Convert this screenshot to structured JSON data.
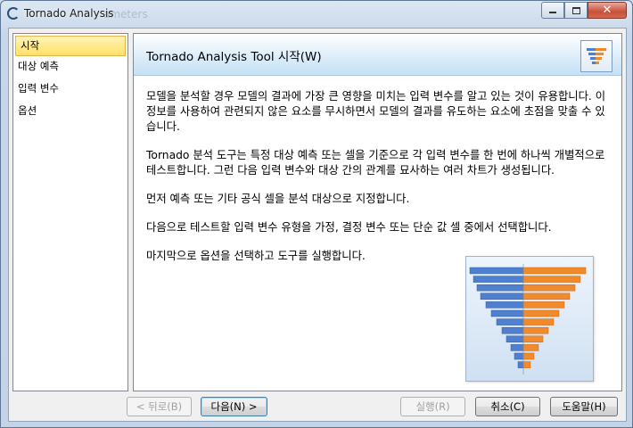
{
  "window": {
    "title": "Tornado Analysis",
    "ghost_title": "ameters",
    "min_icon": "minimize-icon",
    "max_icon": "maximize-icon",
    "close_icon": "close-icon",
    "close_glyph": "✕"
  },
  "nav": {
    "items": [
      {
        "label": "시작",
        "active": true
      },
      {
        "label": "대상 예측",
        "active": false
      },
      {
        "label": "입력 변수",
        "active": false
      },
      {
        "label": "옵션",
        "active": false
      }
    ]
  },
  "panel": {
    "title": "Tornado  Analysis  Tool 시작(W)",
    "header_icon": "tornado-chart-icon",
    "paragraphs": [
      "모델을 분석할 경우 모델의 결과에 가장 큰 영향을 미치는 입력 변수를 알고 있는 것이 유용합니다. 이 정보를 사용하여 관련되지 않은 요소를 무시하면서 모델의 결과를 유도하는 요소에 초점을 맞출 수 있습니다.",
      "Tornado 분석 도구는 특정 대상 예측 또는 셀을 기준으로 각 입력 변수를 한 번에 하나씩 개별적으로 테스트합니다. 그런 다음 입력 변수와 대상 간의 관계를 묘사하는 여러 차트가 생성됩니다.",
      "먼저 예측 또는 기타 공식 셀을 분석 대상으로 지정합니다.",
      "다음으로 테스트할 입력 변수 유형을 가정, 결정 변수 또는 단순 값 셀 중에서 선택합니다.",
      "마지막으로 옵션을 선택하고 도구를 실행합니다."
    ],
    "illustration_icon": "tornado-chart-illustration",
    "colors": {
      "blue_bar": "#4f7fcf",
      "orange_bar": "#f08a2a"
    }
  },
  "footer": {
    "back_label": "< 뒤로(B)",
    "next_label": "다음(N) >",
    "run_label": "실행(R)",
    "cancel_label": "취소(C)",
    "help_label": "도움말(H)"
  }
}
